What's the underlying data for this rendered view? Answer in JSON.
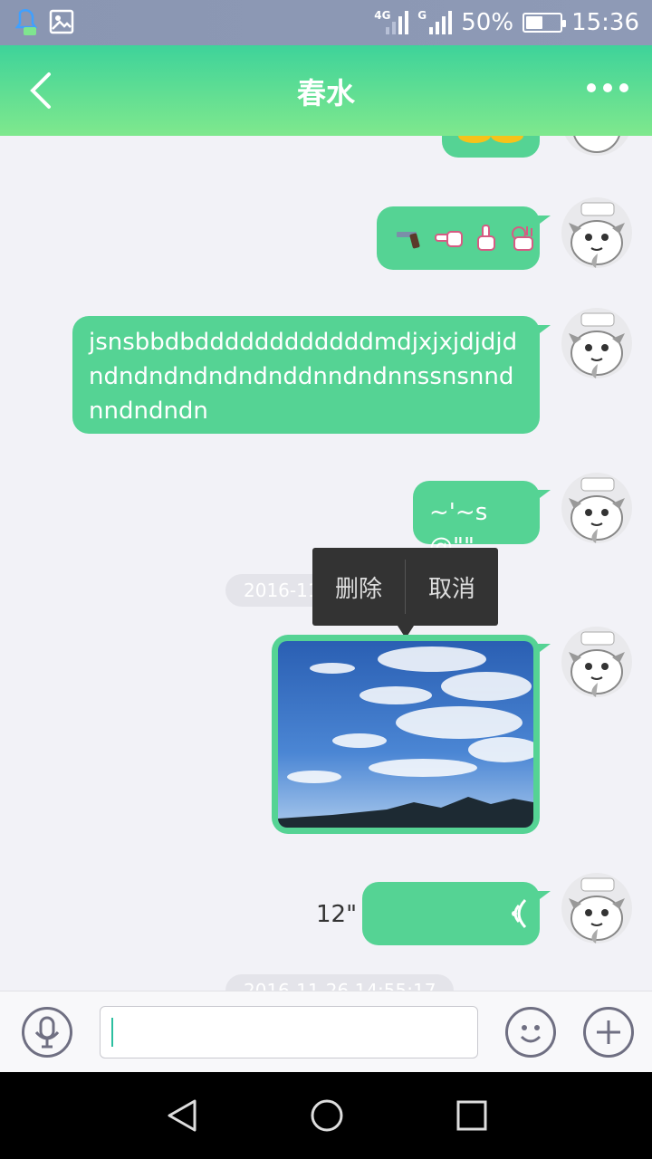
{
  "status_bar": {
    "network_1": "4G",
    "network_2": "G",
    "battery": "50%",
    "battery_level": 0.5,
    "time": "15:36"
  },
  "header": {
    "title": "春水"
  },
  "messages": [
    {
      "type": "emoji",
      "icons": [
        "pistol-icon",
        "pointing-left-hand-icon",
        "pointing-up-hand-icon",
        "ok-hand-icon"
      ]
    },
    {
      "type": "text",
      "text": "jsnsbbdbddddddddddddmdjxjxjdjdjdndndndndndndnddnndndnnssnsnndnndndndn"
    },
    {
      "type": "text",
      "text": "~'~s@\"\""
    },
    {
      "type": "image",
      "description": "sky-photo"
    },
    {
      "type": "voice",
      "duration": "12\""
    }
  ],
  "timestamps": {
    "first": "2016-11-26 14:55:17",
    "second": "2016-11-26 14:55:17"
  },
  "popup": {
    "delete_label": "删除",
    "cancel_label": "取消"
  },
  "colors": {
    "accent": "#55d394",
    "header_top": "#3ed39a",
    "header_bottom": "#7fe88d"
  }
}
